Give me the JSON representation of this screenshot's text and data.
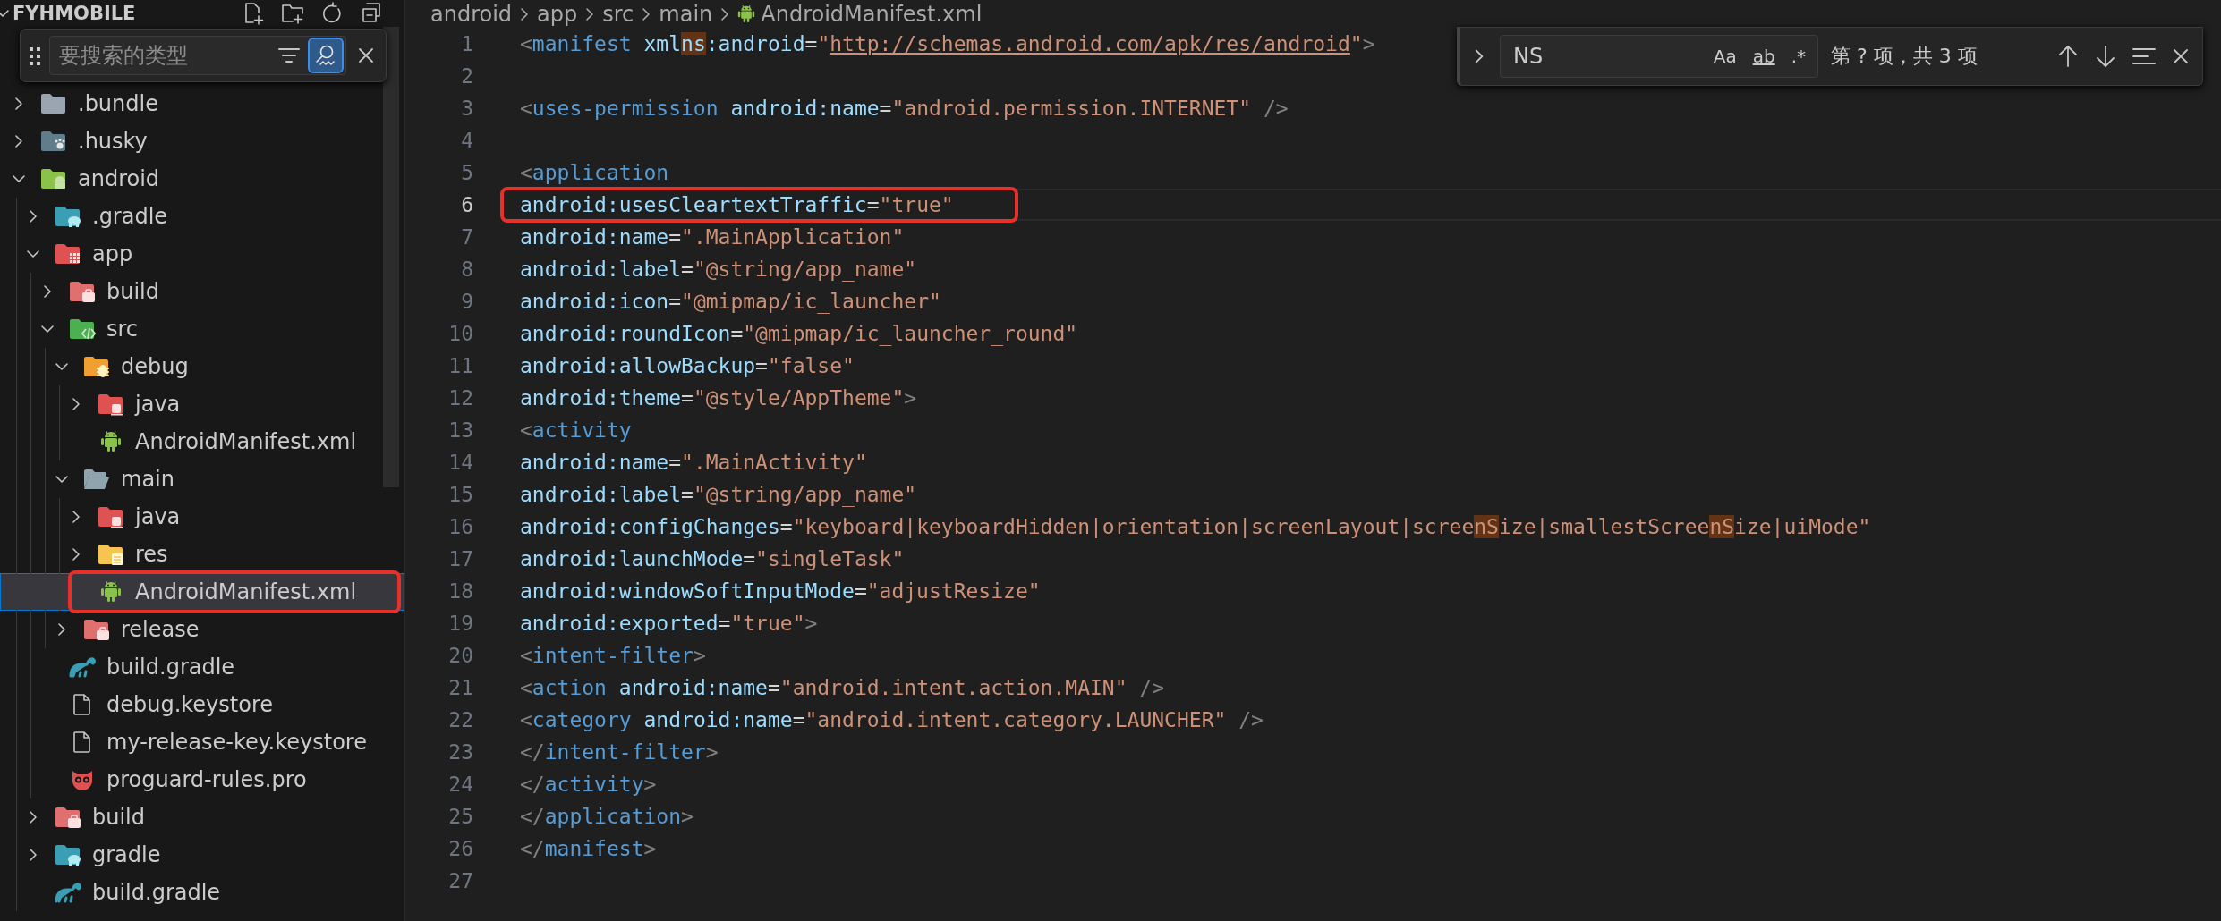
{
  "explorer": {
    "title": "FYHMOBILE",
    "expanded": true,
    "filter": {
      "placeholder": "要搜索的类型",
      "fuzzy": true
    },
    "tree": [
      {
        "name": ".bundle",
        "kind": "bundle",
        "expanded": false,
        "selected": false,
        "boxed": false
      },
      {
        "name": ".husky",
        "kind": "husky",
        "expanded": false,
        "selected": false,
        "boxed": false
      },
      {
        "name": "android",
        "kind": "android",
        "expanded": true,
        "selected": false,
        "boxed": false,
        "children": [
          {
            "name": ".gradle",
            "kind": "gradle",
            "expanded": false,
            "selected": false,
            "boxed": false
          },
          {
            "name": "app",
            "kind": "app",
            "expanded": true,
            "selected": false,
            "boxed": false,
            "children": [
              {
                "name": "build",
                "kind": "build",
                "expanded": false,
                "selected": false,
                "boxed": false
              },
              {
                "name": "src",
                "kind": "src",
                "expanded": true,
                "selected": false,
                "boxed": false,
                "children": [
                  {
                    "name": "debug",
                    "kind": "debug",
                    "expanded": true,
                    "selected": false,
                    "boxed": false,
                    "children": [
                      {
                        "name": "java",
                        "kind": "java",
                        "expanded": false,
                        "selected": false,
                        "boxed": false
                      },
                      {
                        "name": "AndroidManifest.xml",
                        "kind": "manifest",
                        "selected": false,
                        "boxed": false
                      }
                    ]
                  },
                  {
                    "name": "main",
                    "kind": "main",
                    "expanded": true,
                    "selected": false,
                    "boxed": false,
                    "children": [
                      {
                        "name": "java",
                        "kind": "java",
                        "expanded": false,
                        "selected": false,
                        "boxed": false
                      },
                      {
                        "name": "res",
                        "kind": "res",
                        "expanded": false,
                        "selected": false,
                        "boxed": false
                      },
                      {
                        "name": "AndroidManifest.xml",
                        "kind": "manifest",
                        "selected": true,
                        "boxed": true
                      }
                    ]
                  },
                  {
                    "name": "release",
                    "kind": "build",
                    "expanded": false,
                    "selected": false,
                    "boxed": false
                  }
                ]
              },
              {
                "name": "build.gradle",
                "kind": "elephant",
                "selected": false,
                "boxed": false
              },
              {
                "name": "debug.keystore",
                "kind": "file",
                "selected": false,
                "boxed": false
              },
              {
                "name": "my-release-key.keystore",
                "kind": "file",
                "selected": false,
                "boxed": false
              },
              {
                "name": "proguard-rules.pro",
                "kind": "owl",
                "selected": false,
                "boxed": false
              }
            ]
          },
          {
            "name": "build",
            "kind": "build",
            "expanded": false,
            "selected": false,
            "boxed": false
          },
          {
            "name": "gradle",
            "kind": "gradle",
            "expanded": false,
            "selected": false,
            "boxed": false
          },
          {
            "name": "build.gradle",
            "kind": "elephant",
            "selected": false,
            "boxed": false
          }
        ]
      }
    ]
  },
  "breadcrumb": [
    "android",
    "app",
    "src",
    "main",
    "AndroidManifest.xml"
  ],
  "find": {
    "replace_expanded": false,
    "query": "NS",
    "options": [
      {
        "label": "Aa",
        "on": false
      },
      {
        "label": "ab",
        "on": false
      },
      {
        "label": ".*",
        "on": false
      }
    ],
    "count": "第 ? 项，共 3 项"
  },
  "code": {
    "lines": [
      {
        "number": "1",
        "current": false,
        "boxed": false,
        "tokens": [
          {
            "text": "<",
            "kind": "bracket",
            "match": false
          },
          {
            "text": "manifest",
            "kind": "tag",
            "match": false
          },
          {
            "text": " xml",
            "kind": "attr",
            "match": false
          },
          {
            "text": "ns",
            "kind": "attr",
            "match": true
          },
          {
            "text": ":android",
            "kind": "attr",
            "match": false
          },
          {
            "text": "=",
            "kind": "equals",
            "match": false
          },
          {
            "text": "\"",
            "kind": "string",
            "match": false
          },
          {
            "text": "http://schemas.android.com/apk/res/android",
            "kind": "link",
            "match": false
          },
          {
            "text": "\"",
            "kind": "string",
            "match": false
          },
          {
            "text": ">",
            "kind": "bracket",
            "match": false
          }
        ]
      },
      {
        "number": "2",
        "current": false,
        "boxed": false
      },
      {
        "number": "3",
        "current": false,
        "boxed": false,
        "tokens": [
          {
            "text": "    <",
            "kind": "bracket",
            "match": false
          },
          {
            "text": "uses-permission",
            "kind": "tag",
            "match": false
          },
          {
            "text": " android:name",
            "kind": "attr",
            "match": false
          },
          {
            "text": "=",
            "kind": "equals",
            "match": false
          },
          {
            "text": "\"android.permission.INTERNET\"",
            "kind": "string",
            "match": false
          },
          {
            "text": " />",
            "kind": "bracket",
            "match": false
          }
        ]
      },
      {
        "number": "4",
        "current": false,
        "boxed": false
      },
      {
        "number": "5",
        "current": false,
        "boxed": false,
        "tokens": [
          {
            "text": "    <",
            "kind": "bracket",
            "match": false
          },
          {
            "text": "application",
            "kind": "tag",
            "match": false
          }
        ]
      },
      {
        "number": "6",
        "current": true,
        "boxed": true,
        "tokens": [
          {
            "text": "      android:usesCleartextTraffic",
            "kind": "attr",
            "match": false
          },
          {
            "text": "=",
            "kind": "equals",
            "match": false
          },
          {
            "text": "\"true\"",
            "kind": "string",
            "match": false
          }
        ]
      },
      {
        "number": "7",
        "current": false,
        "boxed": false,
        "tokens": [
          {
            "text": "      android:name",
            "kind": "attr",
            "match": false
          },
          {
            "text": "=",
            "kind": "equals",
            "match": false
          },
          {
            "text": "\".MainApplication\"",
            "kind": "string",
            "match": false
          }
        ]
      },
      {
        "number": "8",
        "current": false,
        "boxed": false,
        "tokens": [
          {
            "text": "      android:label",
            "kind": "attr",
            "match": false
          },
          {
            "text": "=",
            "kind": "equals",
            "match": false
          },
          {
            "text": "\"@string/app_name\"",
            "kind": "string",
            "match": false
          }
        ]
      },
      {
        "number": "9",
        "current": false,
        "boxed": false,
        "tokens": [
          {
            "text": "      android:icon",
            "kind": "attr",
            "match": false
          },
          {
            "text": "=",
            "kind": "equals",
            "match": false
          },
          {
            "text": "\"@mipmap/ic_launcher\"",
            "kind": "string",
            "match": false
          }
        ]
      },
      {
        "number": "10",
        "current": false,
        "boxed": false,
        "tokens": [
          {
            "text": "      android:roundIcon",
            "kind": "attr",
            "match": false
          },
          {
            "text": "=",
            "kind": "equals",
            "match": false
          },
          {
            "text": "\"@mipmap/ic_launcher_round\"",
            "kind": "string",
            "match": false
          }
        ]
      },
      {
        "number": "11",
        "current": false,
        "boxed": false,
        "tokens": [
          {
            "text": "      android:allowBackup",
            "kind": "attr",
            "match": false
          },
          {
            "text": "=",
            "kind": "equals",
            "match": false
          },
          {
            "text": "\"false\"",
            "kind": "string",
            "match": false
          }
        ]
      },
      {
        "number": "12",
        "current": false,
        "boxed": false,
        "tokens": [
          {
            "text": "      android:theme",
            "kind": "attr",
            "match": false
          },
          {
            "text": "=",
            "kind": "equals",
            "match": false
          },
          {
            "text": "\"@style/AppTheme\"",
            "kind": "string",
            "match": false
          },
          {
            "text": ">",
            "kind": "bracket",
            "match": false
          }
        ]
      },
      {
        "number": "13",
        "current": false,
        "boxed": false,
        "tokens": [
          {
            "text": "      <",
            "kind": "bracket",
            "match": false
          },
          {
            "text": "activity",
            "kind": "tag",
            "match": false
          }
        ]
      },
      {
        "number": "14",
        "current": false,
        "boxed": false,
        "tokens": [
          {
            "text": "        android:name",
            "kind": "attr",
            "match": false
          },
          {
            "text": "=",
            "kind": "equals",
            "match": false
          },
          {
            "text": "\".MainActivity\"",
            "kind": "string",
            "match": false
          }
        ]
      },
      {
        "number": "15",
        "current": false,
        "boxed": false,
        "tokens": [
          {
            "text": "        android:label",
            "kind": "attr",
            "match": false
          },
          {
            "text": "=",
            "kind": "equals",
            "match": false
          },
          {
            "text": "\"@string/app_name\"",
            "kind": "string",
            "match": false
          }
        ]
      },
      {
        "number": "16",
        "current": false,
        "boxed": false,
        "tokens": [
          {
            "text": "        android:configChanges",
            "kind": "attr",
            "match": false
          },
          {
            "text": "=",
            "kind": "equals",
            "match": false
          },
          {
            "text": "\"keyboard|keyboardHidden|orientation|screenLayout|scree",
            "kind": "string",
            "match": false
          },
          {
            "text": "nS",
            "kind": "string",
            "match": true
          },
          {
            "text": "ize|smallestScree",
            "kind": "string",
            "match": false
          },
          {
            "text": "nS",
            "kind": "string",
            "match": true
          },
          {
            "text": "ize|uiMode\"",
            "kind": "string",
            "match": false
          }
        ]
      },
      {
        "number": "17",
        "current": false,
        "boxed": false,
        "tokens": [
          {
            "text": "        android:launchMode",
            "kind": "attr",
            "match": false
          },
          {
            "text": "=",
            "kind": "equals",
            "match": false
          },
          {
            "text": "\"singleTask\"",
            "kind": "string",
            "match": false
          }
        ]
      },
      {
        "number": "18",
        "current": false,
        "boxed": false,
        "tokens": [
          {
            "text": "        android:windowSoftInputMode",
            "kind": "attr",
            "match": false
          },
          {
            "text": "=",
            "kind": "equals",
            "match": false
          },
          {
            "text": "\"adjustResize\"",
            "kind": "string",
            "match": false
          }
        ]
      },
      {
        "number": "19",
        "current": false,
        "boxed": false,
        "tokens": [
          {
            "text": "        android:exported",
            "kind": "attr",
            "match": false
          },
          {
            "text": "=",
            "kind": "equals",
            "match": false
          },
          {
            "text": "\"true\"",
            "kind": "string",
            "match": false
          },
          {
            "text": ">",
            "kind": "bracket",
            "match": false
          }
        ]
      },
      {
        "number": "20",
        "current": false,
        "boxed": false,
        "tokens": [
          {
            "text": "        <",
            "kind": "bracket",
            "match": false
          },
          {
            "text": "intent-filter",
            "kind": "tag",
            "match": false
          },
          {
            "text": ">",
            "kind": "bracket",
            "match": false
          }
        ]
      },
      {
        "number": "21",
        "current": false,
        "boxed": false,
        "tokens": [
          {
            "text": "            <",
            "kind": "bracket",
            "match": false
          },
          {
            "text": "action",
            "kind": "tag",
            "match": false
          },
          {
            "text": " android:name",
            "kind": "attr",
            "match": false
          },
          {
            "text": "=",
            "kind": "equals",
            "match": false
          },
          {
            "text": "\"android.intent.action.MAIN\"",
            "kind": "string",
            "match": false
          },
          {
            "text": " />",
            "kind": "bracket",
            "match": false
          }
        ]
      },
      {
        "number": "22",
        "current": false,
        "boxed": false,
        "tokens": [
          {
            "text": "            <",
            "kind": "bracket",
            "match": false
          },
          {
            "text": "category",
            "kind": "tag",
            "match": false
          },
          {
            "text": " android:name",
            "kind": "attr",
            "match": false
          },
          {
            "text": "=",
            "kind": "equals",
            "match": false
          },
          {
            "text": "\"android.intent.category.LAUNCHER\"",
            "kind": "string",
            "match": false
          },
          {
            "text": " />",
            "kind": "bracket",
            "match": false
          }
        ]
      },
      {
        "number": "23",
        "current": false,
        "boxed": false,
        "tokens": [
          {
            "text": "        </",
            "kind": "bracket",
            "match": false
          },
          {
            "text": "intent-filter",
            "kind": "tag",
            "match": false
          },
          {
            "text": ">",
            "kind": "bracket",
            "match": false
          }
        ]
      },
      {
        "number": "24",
        "current": false,
        "boxed": false,
        "tokens": [
          {
            "text": "      </",
            "kind": "bracket",
            "match": false
          },
          {
            "text": "activity",
            "kind": "tag",
            "match": false
          },
          {
            "text": ">",
            "kind": "bracket",
            "match": false
          }
        ]
      },
      {
        "number": "25",
        "current": false,
        "boxed": false,
        "tokens": [
          {
            "text": "    </",
            "kind": "bracket",
            "match": false
          },
          {
            "text": "application",
            "kind": "tag",
            "match": false
          },
          {
            "text": ">",
            "kind": "bracket",
            "match": false
          }
        ]
      },
      {
        "number": "26",
        "current": false,
        "boxed": false,
        "tokens": [
          {
            "text": "</",
            "kind": "bracket",
            "match": false
          },
          {
            "text": "manifest",
            "kind": "tag",
            "match": false
          },
          {
            "text": ">",
            "kind": "bracket",
            "match": false
          }
        ]
      },
      {
        "number": "27",
        "current": false,
        "boxed": false
      }
    ]
  }
}
